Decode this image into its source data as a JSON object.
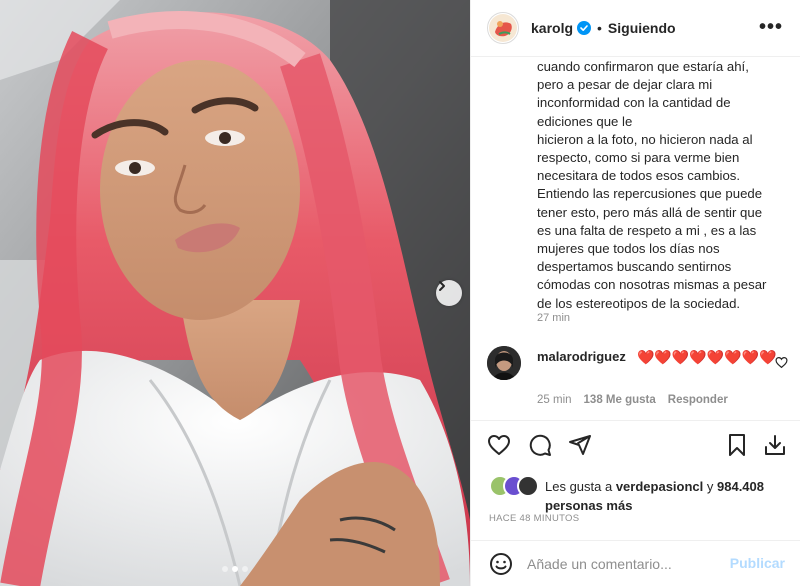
{
  "post": {
    "username": "karolg",
    "separator": "•",
    "follow_status": "Siguiendo",
    "more_label": "•••",
    "verified_color": "#0095f6"
  },
  "caption": {
    "lines": [
      "cuando confirmaron que estaría ahí,",
      "pero a pesar de dejar clara mi",
      "inconformidad con la cantidad de",
      "ediciones que le",
      "hicieron a la foto, no hicieron nada al",
      "respecto, como si para verme bien",
      "necesitara de todos esos cambios.",
      "Entiendo las repercusiones que puede",
      "tener esto, pero más allá de sentir que",
      "es una falta de respeto a mi , es a las",
      "mujeres que todos los días nos",
      "despertamos buscando sentirnos",
      "cómodas con nosotras mismas a pesar",
      "de los estereotipos de la sociedad."
    ],
    "time": "27 min"
  },
  "comment": {
    "username": "malarodriguez",
    "text": "❤️❤️❤️❤️❤️❤️❤️❤️",
    "time": "25 min",
    "likes": "138 Me gusta",
    "reply": "Responder"
  },
  "likes": {
    "prefix": "Les gusta a ",
    "first_user": "verdepasioncl",
    "middle": " y ",
    "count": "984.408",
    "suffix": "personas más"
  },
  "post_time": "HACE 48 MINUTOS",
  "comment_input": {
    "placeholder": "Añade un comentario...",
    "submit": "Publicar"
  },
  "carousel": {
    "dots": 3,
    "active_index": 1
  },
  "colors": {
    "hearts": "#e0192a",
    "publish_disabled": "#b3dbff",
    "hair": "#e8505f"
  }
}
